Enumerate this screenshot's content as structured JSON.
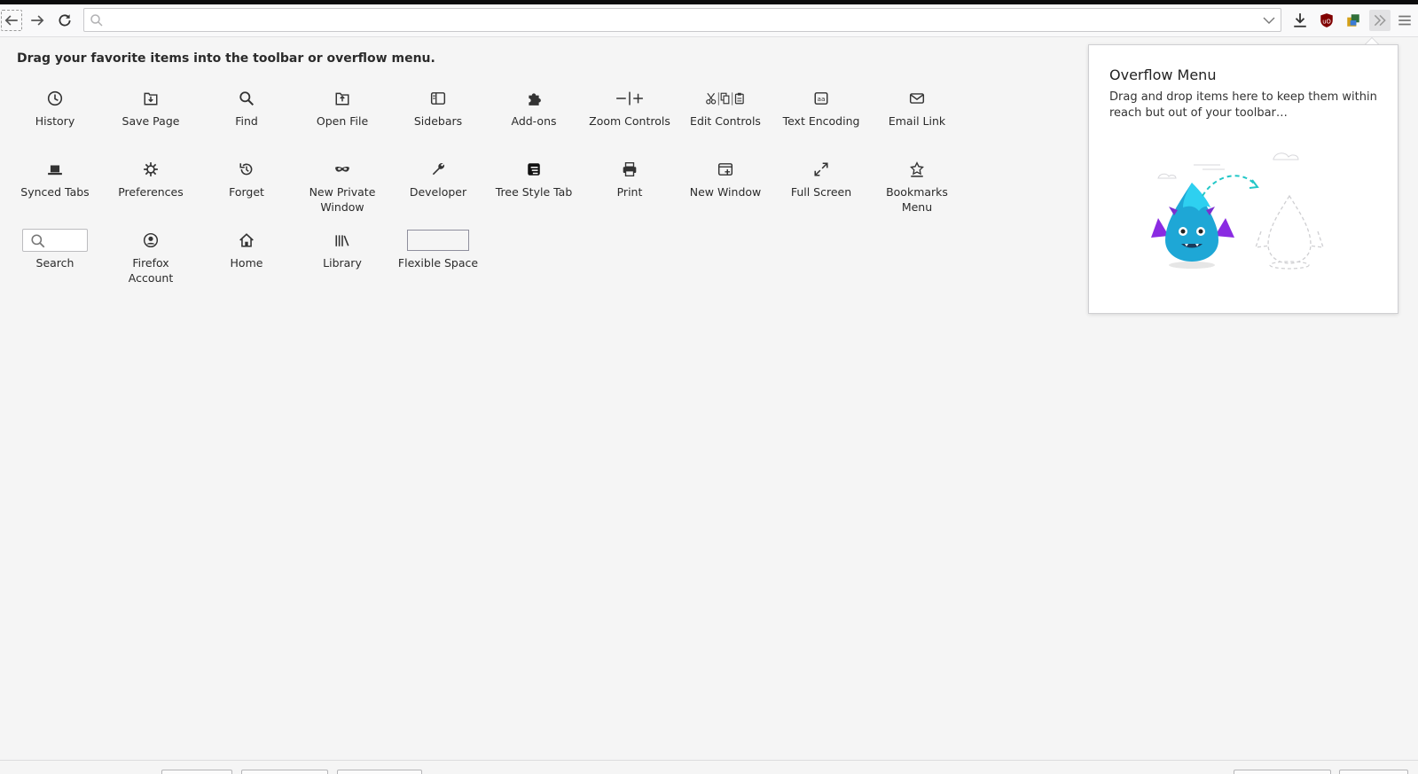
{
  "navbar": {
    "url_placeholder": "",
    "url_value": ""
  },
  "toolbar_icons": [
    "back-icon",
    "forward-icon",
    "reload-icon",
    "download-icon",
    "ublock-icon",
    "extension-icon",
    "overflow-chevron-icon",
    "hamburger-menu-icon"
  ],
  "colors": {
    "ublock_red": "#800000",
    "accent_blue": "#0a84ff",
    "panel_bg": "#ffffff",
    "page_bg": "#f5f5f5"
  },
  "customize": {
    "instructions": "Drag your favorite items into the toolbar or overflow menu."
  },
  "palette": {
    "items": [
      {
        "label": "History",
        "icon": "clock-icon"
      },
      {
        "label": "Save Page",
        "icon": "save-page-icon"
      },
      {
        "label": "Find",
        "icon": "search-icon"
      },
      {
        "label": "Open File",
        "icon": "open-file-icon"
      },
      {
        "label": "Sidebars",
        "icon": "sidebar-icon"
      },
      {
        "label": "Add-ons",
        "icon": "puzzle-icon"
      },
      {
        "label": "Zoom Controls",
        "icon": "zoom-icon"
      },
      {
        "label": "Edit Controls",
        "icon": "cut-copy-paste-icon"
      },
      {
        "label": "Text Encoding",
        "icon": "text-encoding-icon"
      },
      {
        "label": "Email Link",
        "icon": "envelope-icon"
      },
      {
        "label": "Synced Tabs",
        "icon": "laptop-icon"
      },
      {
        "label": "Preferences",
        "icon": "gear-icon"
      },
      {
        "label": "Forget",
        "icon": "forget-icon"
      },
      {
        "label": "New Private Window",
        "icon": "mask-icon"
      },
      {
        "label": "Developer",
        "icon": "wrench-icon"
      },
      {
        "label": "Tree Style Tab",
        "icon": "tree-style-tab-icon"
      },
      {
        "label": "Print",
        "icon": "printer-icon"
      },
      {
        "label": "New Window",
        "icon": "new-window-icon"
      },
      {
        "label": "Full Screen",
        "icon": "fullscreen-icon"
      },
      {
        "label": "Bookmarks Menu",
        "icon": "bookmark-star-icon"
      },
      {
        "label": "Search",
        "icon": "search-icon"
      },
      {
        "label": "Firefox Account",
        "icon": "account-icon"
      },
      {
        "label": "Home",
        "icon": "home-icon"
      },
      {
        "label": "Library",
        "icon": "library-icon"
      },
      {
        "label": "Flexible Space",
        "icon": "flexible-space"
      }
    ]
  },
  "overflow_panel": {
    "title": "Overflow Menu",
    "description": "Drag and drop items here to keep them within reach but out of your toolbar…"
  }
}
